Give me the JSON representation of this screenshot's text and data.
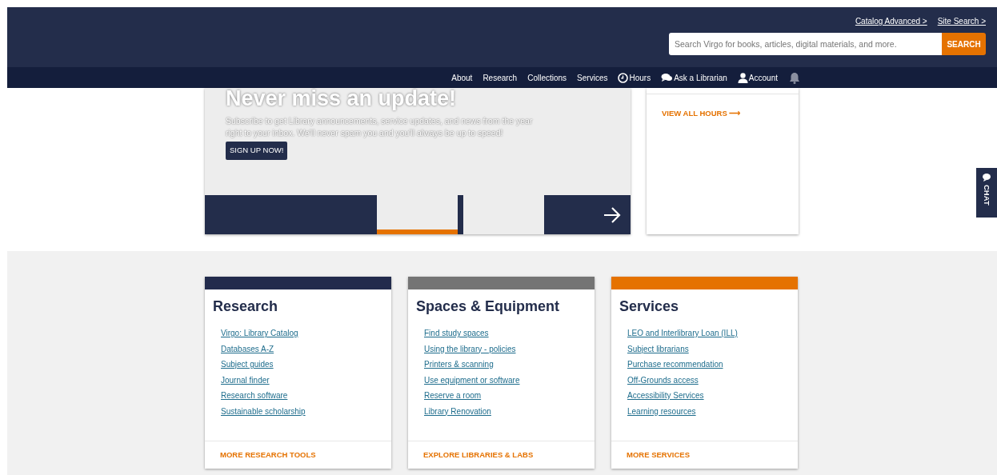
{
  "header": {
    "utility_links": [
      "Catalog Advanced >",
      "Site Search >"
    ],
    "search": {
      "placeholder": "Search Virgo for books, articles, digital materials, and more.",
      "button": "SEARCH"
    }
  },
  "nav": [
    {
      "label": "About",
      "kind": "text"
    },
    {
      "label": "Research",
      "kind": "text"
    },
    {
      "label": "Collections",
      "kind": "text"
    },
    {
      "label": "Services",
      "kind": "text"
    },
    {
      "label": "Hours",
      "kind": "clock"
    },
    {
      "label": "Ask a Librarian",
      "kind": "chat"
    },
    {
      "label": "Account",
      "kind": "person"
    }
  ],
  "hero": {
    "title": "Never miss an update!",
    "text": "Subscribe to get Library announcements, service updates, and news from the year right to your inbox. We'll never spam you and you'll always be up to speed!",
    "button": "SIGN UP NOW!",
    "slides": [
      {
        "selected": true
      },
      {
        "selected": false
      }
    ]
  },
  "hours": {
    "link": "VIEW ALL HOURS ⟶"
  },
  "chat_tab": "CHAT",
  "cards": [
    {
      "title": "Research",
      "color": "#222b4c",
      "links": [
        "Virgo: Library Catalog",
        "Databases A-Z",
        "Subject guides",
        "Journal finder",
        "Research software",
        "Sustainable scholarship"
      ],
      "footer": "MORE RESEARCH TOOLS"
    },
    {
      "title": "Spaces & Equipment",
      "color": "#747474",
      "links": [
        "Find study spaces",
        "Using the library - policies",
        "Printers & scanning",
        "Use equipment or software",
        "Reserve a room",
        "Library Renovation"
      ],
      "footer": "EXPLORE LIBRARIES & LABS"
    },
    {
      "title": "Services",
      "color": "#e57200",
      "links": [
        "LEO and Interlibrary Loan (ILL)",
        "Subject librarians",
        "Purchase recommendation",
        "Off-Grounds access",
        "Accessibility Services",
        "Learning resources"
      ],
      "footer": "MORE SERVICES"
    }
  ]
}
